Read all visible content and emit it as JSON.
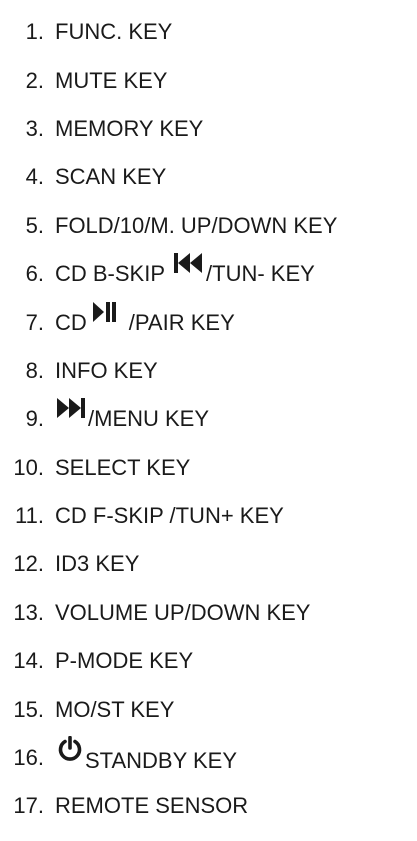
{
  "items": [
    {
      "number": "1.",
      "text": "FUNC. KEY"
    },
    {
      "number": "2.",
      "text": "MUTE KEY"
    },
    {
      "number": "3.",
      "text": "MEMORY KEY"
    },
    {
      "number": "4.",
      "text": "SCAN KEY"
    },
    {
      "number": "5.",
      "text": "FOLD/10/M. UP/DOWN KEY"
    },
    {
      "number": "6.",
      "text_before": "CD B-SKIP",
      "icon": "skip-back-icon",
      "text_after": "/TUN- KEY"
    },
    {
      "number": "7.",
      "text_before": "CD",
      "icon": "play-pause-icon",
      "text_after": "/PAIR KEY"
    },
    {
      "number": "8.",
      "text": "INFO KEY"
    },
    {
      "number": "9.",
      "icon": "skip-forward-icon",
      "text_after": "/MENU KEY"
    },
    {
      "number": "10.",
      "text": "SELECT KEY"
    },
    {
      "number": "11.",
      "text": "CD F-SKIP /TUN+ KEY"
    },
    {
      "number": "12.",
      "text": "ID3 KEY"
    },
    {
      "number": "13.",
      "text": "VOLUME UP/DOWN KEY"
    },
    {
      "number": "14.",
      "text": "P-MODE KEY"
    },
    {
      "number": "15.",
      "text": "MO/ST KEY"
    },
    {
      "number": "16.",
      "icon": "power-icon",
      "text_after": "STANDBY KEY"
    },
    {
      "number": "17.",
      "text": "REMOTE SENSOR"
    }
  ],
  "colors": {
    "text": "#1a1a1a",
    "background": "#ffffff"
  }
}
